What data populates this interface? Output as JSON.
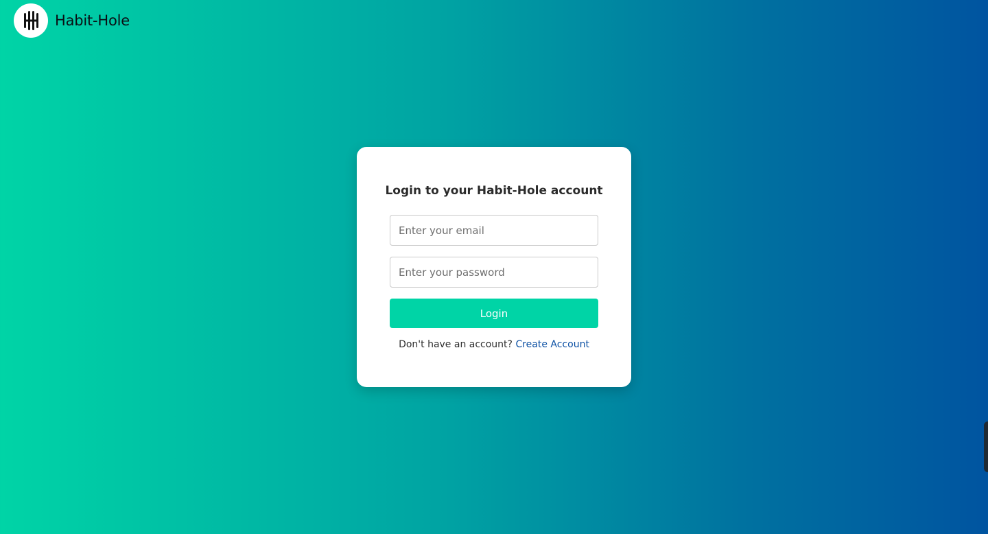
{
  "brand": {
    "name": "Habit-Hole",
    "logo_icon": "habit-hole-logo-icon"
  },
  "login_card": {
    "title": "Login to your Habit-Hole account",
    "email_placeholder": "Enter your email",
    "email_value": "",
    "password_placeholder": "Enter your password",
    "password_value": "",
    "login_label": "Login",
    "signup_prompt": "Don't have an account?",
    "signup_link_label": "Create Account"
  },
  "colors": {
    "gradient_start": "#00d4a6",
    "gradient_end": "#0054a0",
    "primary_button": "#00d4a6",
    "link": "#0a4fa3"
  }
}
